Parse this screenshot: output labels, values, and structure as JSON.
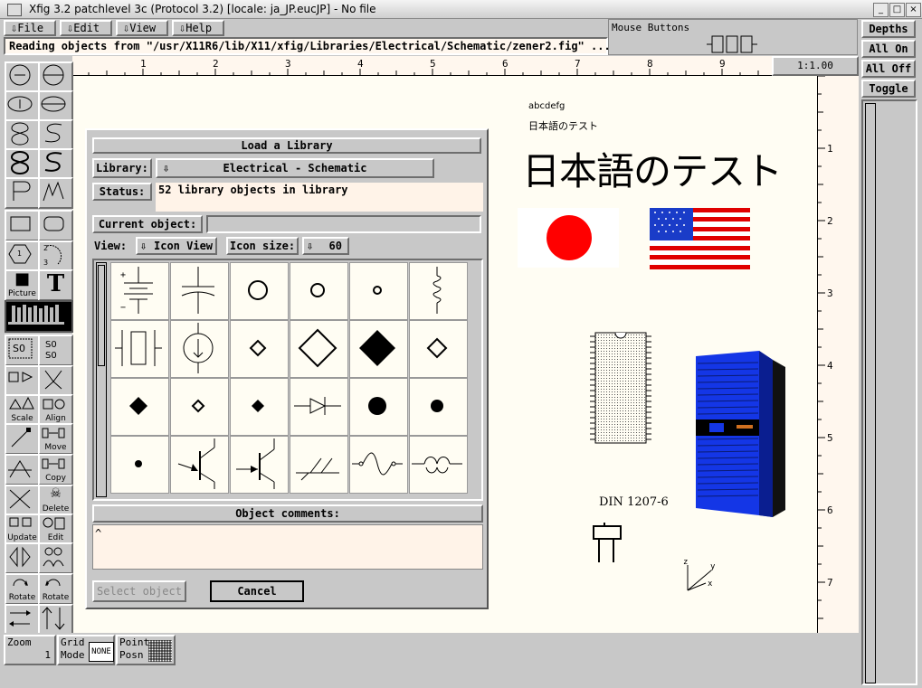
{
  "window": {
    "title": "Xfig 3.2 patchlevel 3c (Protocol 3.2) [locale: ja_JP.eucJP] - No file",
    "buttons": [
      "_",
      "□",
      "×"
    ]
  },
  "menu": [
    "File",
    "Edit",
    "View",
    "Help"
  ],
  "mouse_buttons_label": "Mouse Buttons",
  "message": "Reading objects from \"/usr/X11R6/lib/X11/xfig/Libraries/Electrical/Schematic/zener2.fig\" ...",
  "ruler": {
    "units": "1:1.00",
    "top_ticks": [
      "1",
      "2",
      "3",
      "4",
      "5",
      "6",
      "7",
      "8",
      "9"
    ],
    "side_ticks": [
      "1",
      "2",
      "3",
      "4",
      "5",
      "6",
      "7"
    ]
  },
  "depths": {
    "title": "Depths",
    "all_on": "All On",
    "all_off": "All Off",
    "toggle": "Toggle"
  },
  "tools": {
    "picture": "Picture",
    "scale": "Scale",
    "align": "Align",
    "move": "Move",
    "copy": "Copy",
    "delete": "Delete",
    "update": "Update",
    "edit": "Edit",
    "rotate1": "Rotate",
    "rotate2": "Rotate",
    "text_glyph": "T",
    "ellipse_labels": [
      "1",
      "2",
      "3"
    ]
  },
  "bottom": {
    "zoom_label": "Zoom",
    "zoom_value": "1",
    "grid_label": "Grid",
    "grid_mode": "Mode",
    "grid_value": "NONE",
    "point_label": "Point",
    "point_posn": "Posn"
  },
  "dialog": {
    "title": "Load a Library",
    "library_label": "Library:",
    "library_value": "Electrical - Schematic",
    "status_label": "Status:",
    "status_value": "52 library objects in library",
    "current_label": "Current object:",
    "view_label": "View:",
    "view_value": "Icon View",
    "iconsize_label": "Icon size:",
    "iconsize_value": "60",
    "comments_label": "Object comments:",
    "comments_value": "^",
    "select_button": "Select object",
    "cancel_button": "Cancel"
  },
  "canvas": {
    "small_text1": "abcdefg",
    "small_text2": "日本語のテスト",
    "big_text": "日本語のテスト",
    "din_label": "DIN 1207-6",
    "axis_labels": [
      "z",
      "y",
      "x"
    ]
  },
  "colors": {
    "japan_red": "#ff0000",
    "us_red": "#e00000",
    "us_blue": "#1a3cc8",
    "server_blue": "#1436e6"
  }
}
